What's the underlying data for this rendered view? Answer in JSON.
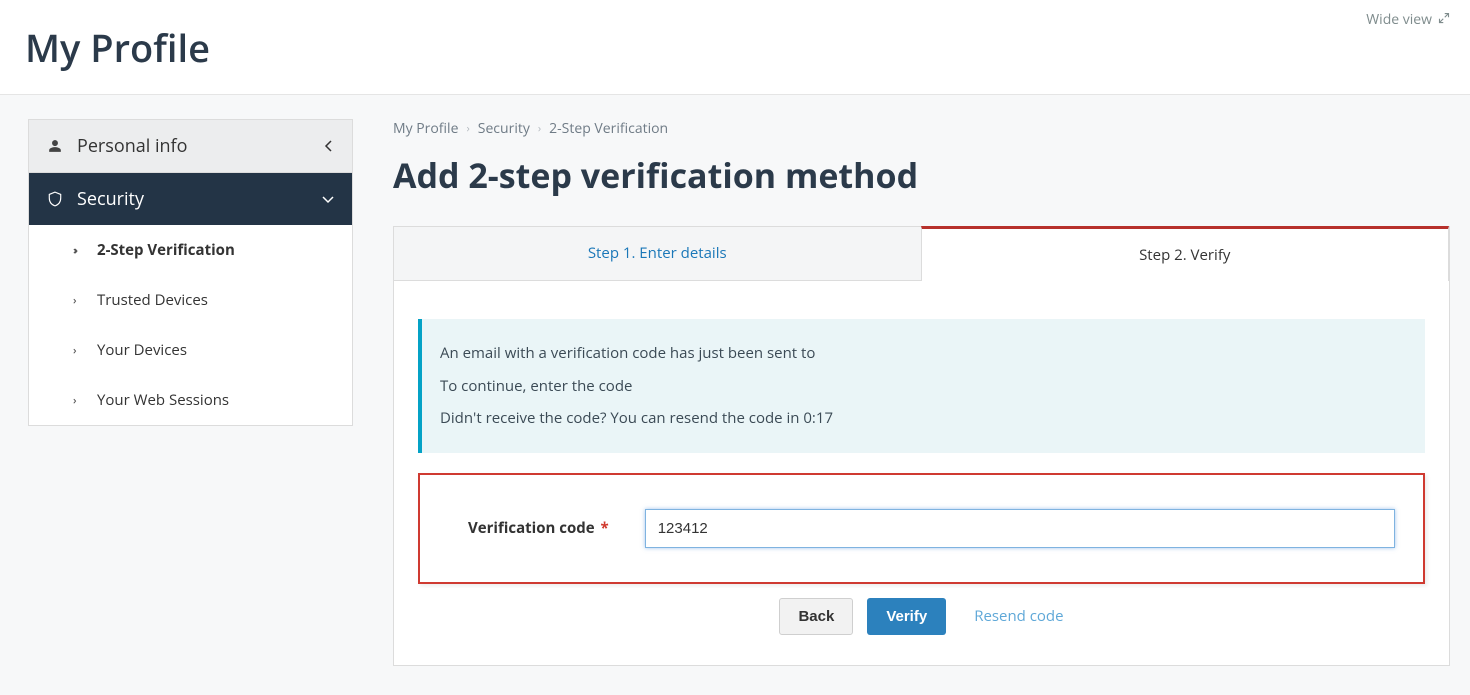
{
  "header": {
    "page_title": "My Profile",
    "wide_view": "Wide view"
  },
  "sidebar": {
    "personal_info": {
      "label": "Personal info"
    },
    "security": {
      "label": "Security",
      "items": [
        {
          "label": "2-Step Verification"
        },
        {
          "label": "Trusted Devices"
        },
        {
          "label": "Your Devices"
        },
        {
          "label": "Your Web Sessions"
        }
      ]
    }
  },
  "breadcrumb": {
    "a": "My Profile",
    "b": "Security",
    "c": "2-Step Verification"
  },
  "main": {
    "heading": "Add 2-step verification method",
    "tab1": "Step 1. Enter details",
    "tab2": "Step 2. Verify"
  },
  "info": {
    "line1": "An email with a verification code has just been sent to",
    "line2": "To continue, enter the code",
    "line3": "Didn't receive the code? You can resend the code in 0:17"
  },
  "form": {
    "label": "Verification code",
    "value": "123412"
  },
  "buttons": {
    "back": "Back",
    "verify": "Verify",
    "resend": "Resend code"
  }
}
